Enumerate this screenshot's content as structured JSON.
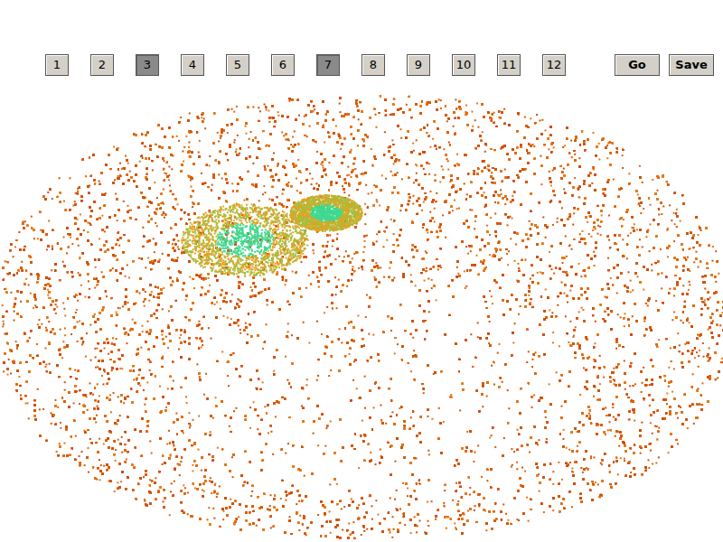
{
  "slice_buttons": [
    {
      "label": "1",
      "selected": false
    },
    {
      "label": "2",
      "selected": false
    },
    {
      "label": "3",
      "selected": true
    },
    {
      "label": "4",
      "selected": false
    },
    {
      "label": "5",
      "selected": false
    },
    {
      "label": "6",
      "selected": false
    },
    {
      "label": "7",
      "selected": true
    },
    {
      "label": "8",
      "selected": false
    },
    {
      "label": "9",
      "selected": false
    },
    {
      "label": "10",
      "selected": false
    },
    {
      "label": "11",
      "selected": false
    },
    {
      "label": "12",
      "selected": false
    }
  ],
  "actions": [
    "Go",
    "Save"
  ]
}
